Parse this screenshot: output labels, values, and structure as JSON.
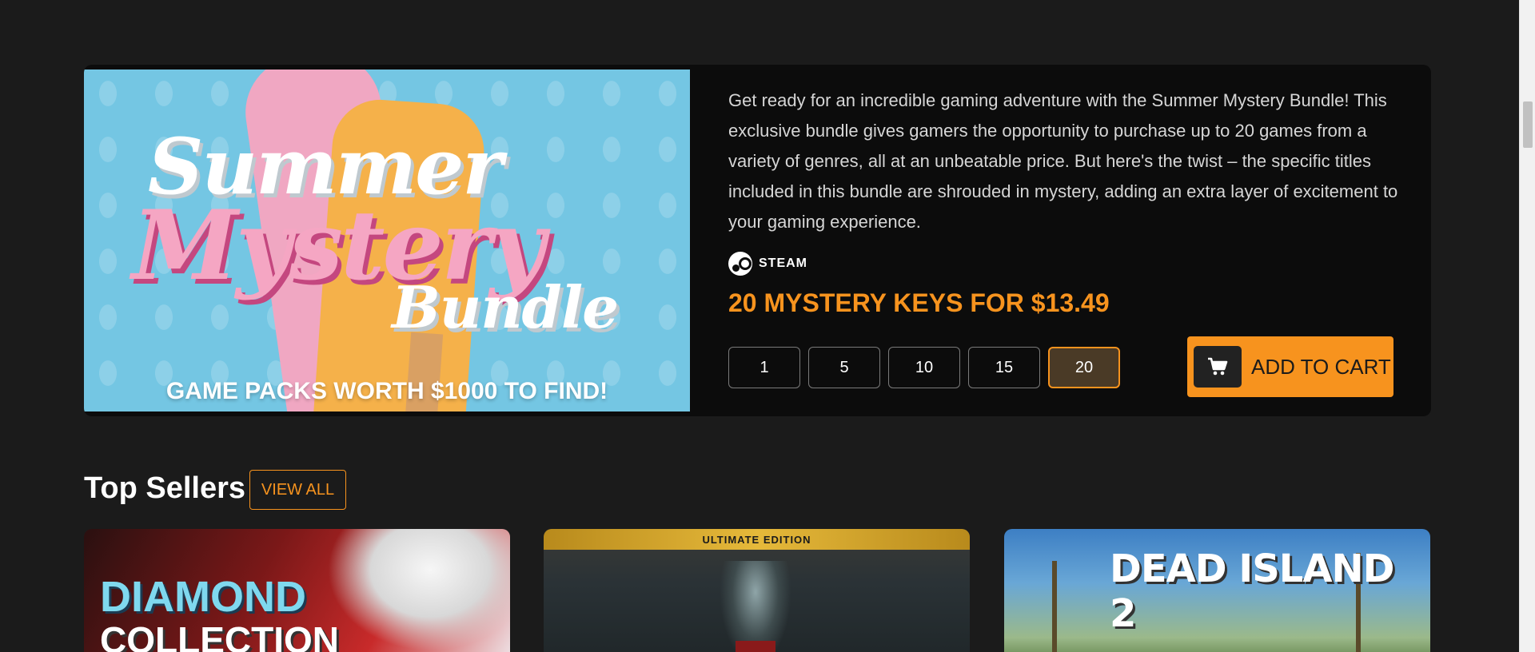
{
  "promo": {
    "image": {
      "title_line1": "Summer",
      "title_line2": "Mystery",
      "title_line3": "Bundle",
      "tagline": "GAME PACKS WORTH $1000 TO FIND!"
    },
    "description": "Get ready for an incredible gaming adventure with the Summer Mystery Bundle! This exclusive bundle gives gamers the opportunity to purchase up to 20 games from a variety of genres, all at an unbeatable price. But here's the twist – the specific titles included in this bundle are shrouded in mystery, adding an extra layer of excitement to your gaming experience.",
    "platform": {
      "icon": "steam-icon",
      "label": "STEAM"
    },
    "offer": "20 MYSTERY KEYS FOR $13.49",
    "quantities": [
      "1",
      "5",
      "10",
      "15",
      "20"
    ],
    "selected_quantity": "20",
    "add_to_cart_label": "ADD TO CART",
    "accent_color": "#f7931e"
  },
  "top_sellers": {
    "title": "Top Sellers",
    "view_all_label": "VIEW ALL",
    "cards": [
      {
        "title_line1": "DIAMOND",
        "title_line2": "COLLECTION"
      },
      {
        "edition": "ULTIMATE EDITION"
      },
      {
        "logo": "DEAD ISLAND 2"
      }
    ]
  }
}
